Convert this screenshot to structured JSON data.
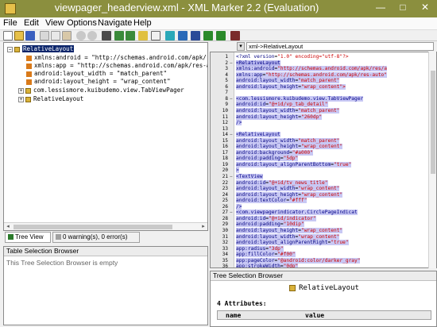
{
  "window": {
    "title": "viewpager_headerview.xml - XML Marker 2.2 (Evaluation)",
    "minimize": "—",
    "maximize": "□",
    "close": "✕"
  },
  "menu": [
    "File",
    "Edit",
    "View",
    "Options",
    "Navigate",
    "Help"
  ],
  "toolbar": {
    "buttons": [
      "new-icon",
      "open-icon",
      "save-icon",
      "cut-icon",
      "copy-icon",
      "paste-icon",
      "undo-icon",
      "redo-icon",
      "find-icon",
      "binoculars-icon",
      "indent-icon",
      "outdent-icon",
      "bookmark-icon",
      "grid-icon",
      "cyan-icon",
      "blue-icon",
      "select-icon",
      "back-icon",
      "forward-icon"
    ]
  },
  "breadcrumb": {
    "value": "xml->RelativeLayout",
    "button": "▾"
  },
  "tree": {
    "root": "RelativeLayout",
    "attributes": [
      "xmlns:android = \"http://schemas.android.com/apk/res/a",
      "xmlns:app = \"http://schemas.android.com/apk/res-aut",
      "android:layout_width = \"match_parent\"",
      "android:layout_height = \"wrap_content\""
    ],
    "children": [
      "com.lessismore.kuibudemo.view.TabViewPager",
      "RelativeLayout"
    ]
  },
  "tabs": {
    "tree_view": "Tree View",
    "warnings": "0 warning(s), 0 error(s)"
  },
  "table_browser": {
    "header": "Table Selection Browser",
    "message": "This Tree Selection Browser is empty"
  },
  "tree_browser": {
    "header": "Tree Selection Browser",
    "node": "RelativeLayout",
    "attr_count": "4 Attributes:",
    "col_name": "name",
    "col_value": "value"
  },
  "code": {
    "lines": [
      {
        "n": "1",
        "t": "<?xml version=\"1.0\" encoding=\"utf-8\"?>",
        "hl": 0
      },
      {
        "n": "2",
        "t": "<RelativeLayout",
        "hl": 2
      },
      {
        "n": "3",
        "t": "    xmlns:android=\"http://schemas.android.com/apk/res/a",
        "hl": 1
      },
      {
        "n": "4",
        "t": "    xmlns:app=\"http://schemas.android.com/apk/res-auto\"",
        "hl": 1
      },
      {
        "n": "5",
        "t": "    android:layout_width=\"match_parent\"",
        "hl": 1
      },
      {
        "n": "6",
        "t": "    android:layout_height=\"wrap_content\">",
        "hl": 1
      },
      {
        "n": "7",
        "t": "",
        "hl": 1
      },
      {
        "n": "8",
        "t": "    <com.lessismore.kuibudemo.view.TabViewPager",
        "hl": 1
      },
      {
        "n": "9",
        "t": "        android:id=\"@+id/vp_tab_detail\"",
        "hl": 1
      },
      {
        "n": "10",
        "t": "        android:layout_width=\"match_parent\"",
        "hl": 1
      },
      {
        "n": "11",
        "t": "        android:layout_height=\"260dp\"",
        "hl": 1
      },
      {
        "n": "12",
        "t": "        />",
        "hl": 1
      },
      {
        "n": "13",
        "t": "",
        "hl": 1
      },
      {
        "n": "14",
        "t": "    <RelativeLayout",
        "hl": 1
      },
      {
        "n": "15",
        "t": "        android:layout_width=\"match_parent\"",
        "hl": 1
      },
      {
        "n": "16",
        "t": "        android:layout_height=\"wrap_content\"",
        "hl": 1
      },
      {
        "n": "17",
        "t": "        android:background=\"#a000\"",
        "hl": 1
      },
      {
        "n": "18",
        "t": "        android:padding=\"5dp\"",
        "hl": 1
      },
      {
        "n": "19",
        "t": "        android:layout_alignParentBottom=\"true\"",
        "hl": 1
      },
      {
        "n": "20",
        "t": "        >",
        "hl": 1
      },
      {
        "n": "21",
        "t": "        <TextView",
        "hl": 1
      },
      {
        "n": "22",
        "t": "            android:id=\"@+id/tv_news_title\"",
        "hl": 1
      },
      {
        "n": "23",
        "t": "            android:layout_width=\"wrap_content\"",
        "hl": 1
      },
      {
        "n": "24",
        "t": "            android:layout_height=\"wrap_content\"",
        "hl": 1
      },
      {
        "n": "25",
        "t": "            android:textColor=\"#fff\"",
        "hl": 1
      },
      {
        "n": "26",
        "t": "            />",
        "hl": 1
      },
      {
        "n": "27",
        "t": "        <com.viewpagerindicator.CirclePageIndicat",
        "hl": 1
      },
      {
        "n": "28",
        "t": "            android:id=\"@+id/indicator\"",
        "hl": 1
      },
      {
        "n": "29",
        "t": "            android:padding=\"10dip\"",
        "hl": 1
      },
      {
        "n": "30",
        "t": "            android:layout_height=\"wrap_content\"",
        "hl": 1
      },
      {
        "n": "31",
        "t": "            android:layout_width=\"wrap_content\"",
        "hl": 1
      },
      {
        "n": "32",
        "t": "            android:layout_alignParentRight=\"true\"",
        "hl": 1
      },
      {
        "n": "33",
        "t": "            app:radius=\"3dp\"",
        "hl": 1
      },
      {
        "n": "34",
        "t": "            app:fillColor=\"#f00\"",
        "hl": 1
      },
      {
        "n": "35",
        "t": "            app:pageColor=\"@android:color/darker_gray\"",
        "hl": 1
      },
      {
        "n": "36",
        "t": "            app:strokeWidth=\"0dp\"",
        "hl": 1
      }
    ]
  },
  "colors": {
    "titlebar": "#8b8f3e",
    "selection": "#0a246a",
    "highlight": "#c8c8f4"
  }
}
